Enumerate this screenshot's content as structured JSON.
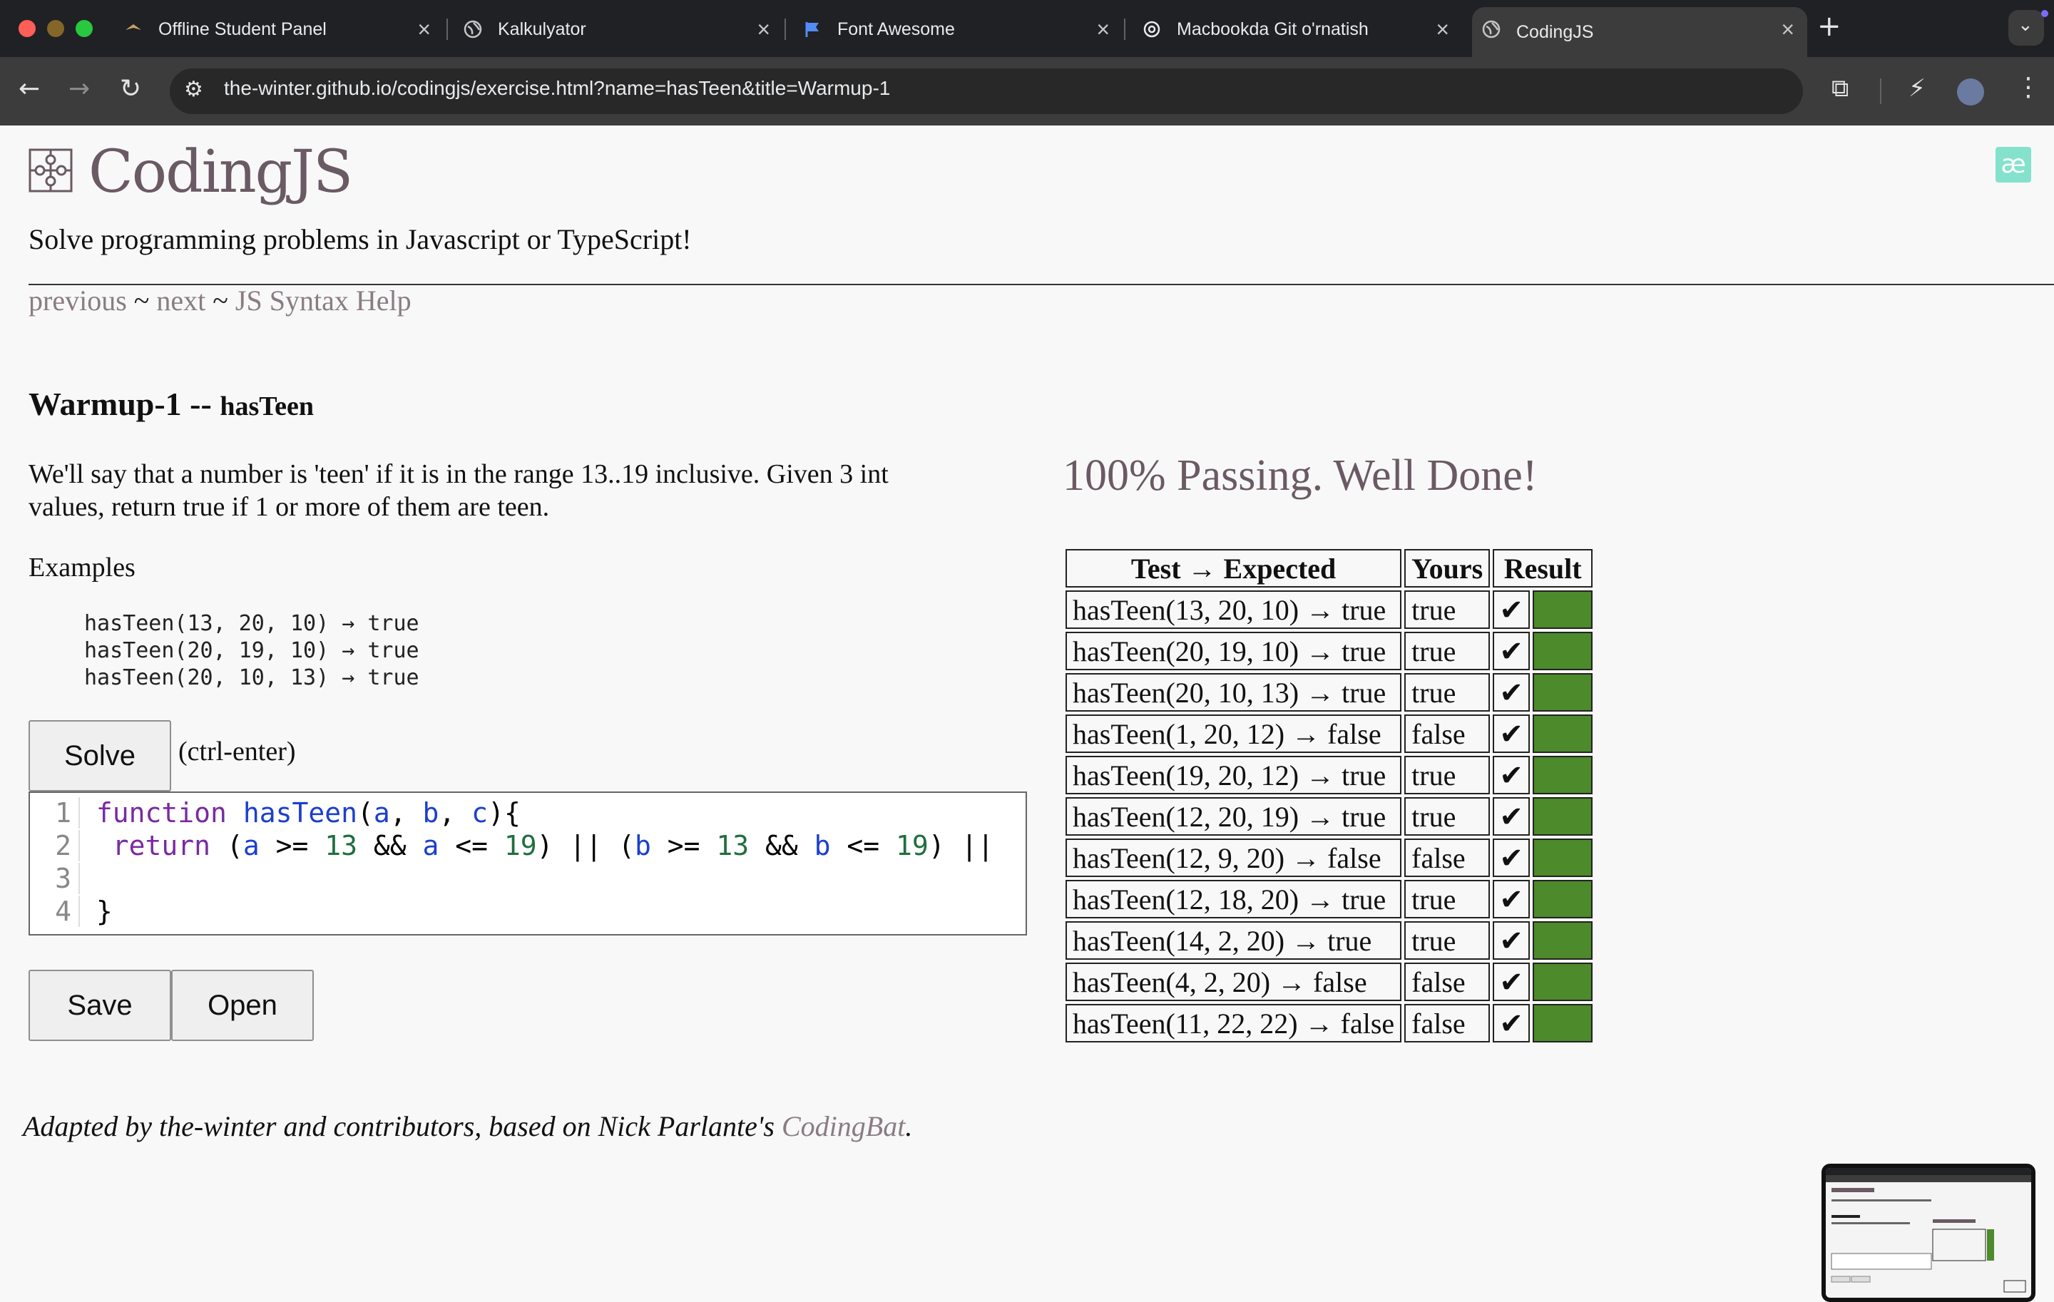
{
  "browser": {
    "tabs": [
      {
        "title": "Offline Student Panel",
        "favicon": "wing-logo-icon",
        "active": false
      },
      {
        "title": "Kalkulyator",
        "favicon": "globe-icon",
        "active": false
      },
      {
        "title": "Font Awesome",
        "favicon": "flag-icon",
        "active": false
      },
      {
        "title": "Macbookda Git o'rnatish",
        "favicon": "openai-icon",
        "active": false
      },
      {
        "title": "CodingJS",
        "favicon": "globe-icon",
        "active": true
      }
    ],
    "url": "the-winter.github.io/codingjs/exercise.html?name=hasTeen&title=Warmup-1"
  },
  "site": {
    "title": "CodingJS",
    "subtitle": "Solve programming problems in Javascript or TypeScript!",
    "nav": {
      "previous": "previous",
      "sep": " ~ ",
      "next": "next",
      "help": "JS Syntax Help"
    }
  },
  "problem": {
    "category": "Warmup-1 --",
    "name": "hasTeen",
    "description": "We'll say that a number is 'teen' if it is in the range 13..19 inclusive. Given 3 int values, return true if 1 or more of them are teen.",
    "examples_label": "Examples",
    "examples": [
      "hasTeen(13, 20, 10) → true",
      "hasTeen(20, 19, 10) → true",
      "hasTeen(20, 10, 13) → true"
    ]
  },
  "editor": {
    "solve_label": "Solve",
    "shortcut_hint": "(ctrl-enter)",
    "line_numbers": [
      "1",
      "2",
      "3",
      "4"
    ],
    "save_label": "Save",
    "open_label": "Open"
  },
  "results": {
    "status": "100% Passing. Well Done!",
    "headers": [
      "Test → Expected",
      "Yours",
      "Result"
    ],
    "pass_color": "#4c8a2b",
    "rows": [
      {
        "test": "hasTeen(13, 20, 10) → true",
        "yours": "true",
        "mark": "✔"
      },
      {
        "test": "hasTeen(20, 19, 10) → true",
        "yours": "true",
        "mark": "✔"
      },
      {
        "test": "hasTeen(20, 10, 13) → true",
        "yours": "true",
        "mark": "✔"
      },
      {
        "test": "hasTeen(1, 20, 12) → false",
        "yours": "false",
        "mark": "✔"
      },
      {
        "test": "hasTeen(19, 20, 12) → true",
        "yours": "true",
        "mark": "✔"
      },
      {
        "test": "hasTeen(12, 20, 19) → true",
        "yours": "true",
        "mark": "✔"
      },
      {
        "test": "hasTeen(12, 9, 20) → false",
        "yours": "false",
        "mark": "✔"
      },
      {
        "test": "hasTeen(12, 18, 20) → true",
        "yours": "true",
        "mark": "✔"
      },
      {
        "test": "hasTeen(14, 2, 20) → true",
        "yours": "true",
        "mark": "✔"
      },
      {
        "test": "hasTeen(4, 2, 20) → false",
        "yours": "false",
        "mark": "✔"
      },
      {
        "test": "hasTeen(11, 22, 22) → false",
        "yours": "false",
        "mark": "✔"
      }
    ]
  },
  "footer": {
    "text": "Adapted by the-winter and contributors, based on Nick Parlante's ",
    "link": "CodingBat",
    "end": "."
  }
}
